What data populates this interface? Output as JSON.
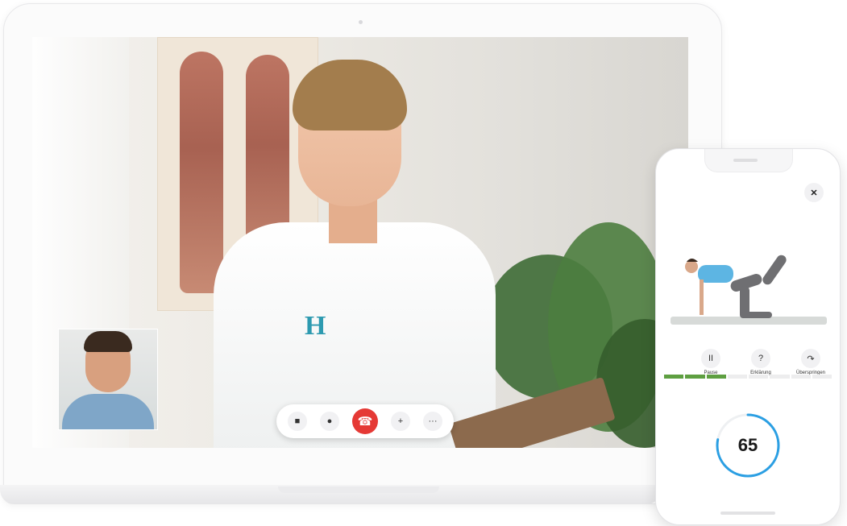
{
  "video_call": {
    "brand_logo": "H",
    "controls": [
      {
        "icon": "camera-icon",
        "glyph": "■"
      },
      {
        "icon": "microphone-icon",
        "glyph": "●"
      },
      {
        "icon": "end-call-icon",
        "glyph": "☎"
      },
      {
        "icon": "add-person-icon",
        "glyph": "+"
      },
      {
        "icon": "more-icon",
        "glyph": "···"
      }
    ]
  },
  "phone": {
    "close_glyph": "✕",
    "exercise_controls": [
      {
        "label": "Pause",
        "icon": "pause-icon",
        "glyph": "II"
      },
      {
        "label": "Erklärung",
        "icon": "question-icon",
        "glyph": "?"
      },
      {
        "label": "Überspringen",
        "icon": "skip-icon",
        "glyph": "↷"
      }
    ],
    "progress": {
      "done_segments": 3,
      "total_segments": 8
    },
    "timer": {
      "value": "65",
      "fraction": 0.78
    },
    "colors": {
      "progress": "#5e9f41",
      "timer_ring": "#2b9fe3",
      "end_call": "#e53935",
      "top_color": "#5db5e3"
    }
  }
}
